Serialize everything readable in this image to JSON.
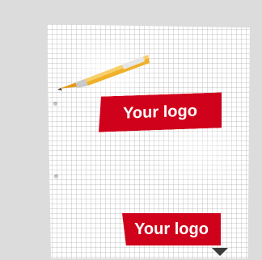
{
  "labels": {
    "logo_top": "Your logo",
    "logo_bottom": "Your logo"
  },
  "icons": {
    "pen": "pen-icon",
    "scroll": "chevron-down-icon"
  },
  "colors": {
    "label_background": "#d0021b",
    "label_text": "#ffffff",
    "background": "#dcdcdc"
  }
}
